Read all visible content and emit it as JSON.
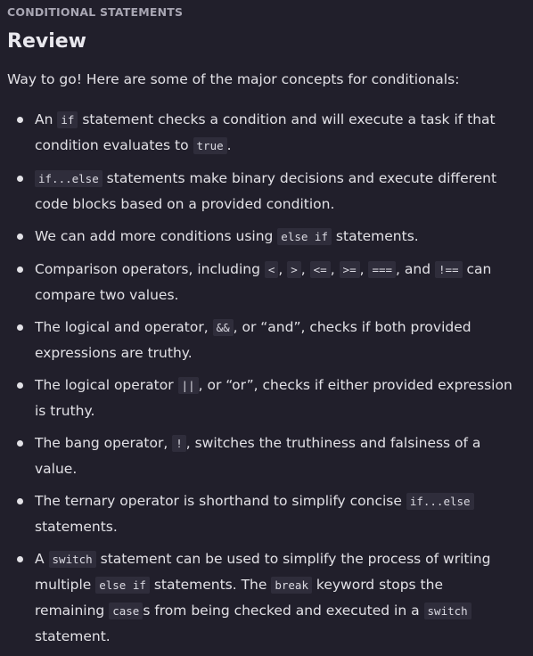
{
  "header": {
    "eyebrow": "CONDITIONAL STATEMENTS",
    "title": "Review",
    "intro": "Way to go! Here are some of the major concepts for conditionals:"
  },
  "items": [
    [
      {
        "t": "An "
      },
      {
        "c": "if"
      },
      {
        "t": " statement checks a condition and will execute a task if that condition evaluates to "
      },
      {
        "c": "true"
      },
      {
        "t": "."
      }
    ],
    [
      {
        "c": "if...else"
      },
      {
        "t": " statements make binary decisions and execute different code blocks based on a provided condition."
      }
    ],
    [
      {
        "t": "We can add more conditions using "
      },
      {
        "c": "else if"
      },
      {
        "t": " statements."
      }
    ],
    [
      {
        "t": "Comparison operators, including "
      },
      {
        "c": "<"
      },
      {
        "t": ", "
      },
      {
        "c": ">"
      },
      {
        "t": ", "
      },
      {
        "c": "<="
      },
      {
        "t": ", "
      },
      {
        "c": ">="
      },
      {
        "t": ", "
      },
      {
        "c": "==="
      },
      {
        "t": ", and "
      },
      {
        "c": "!=="
      },
      {
        "t": " can compare two values."
      }
    ],
    [
      {
        "t": "The logical and operator, "
      },
      {
        "c": "&&"
      },
      {
        "t": ", or “and”, checks if both provided expressions are truthy."
      }
    ],
    [
      {
        "t": "The logical operator "
      },
      {
        "c": "||"
      },
      {
        "t": ", or “or”, checks if either provided expression is truthy."
      }
    ],
    [
      {
        "t": "The bang operator, "
      },
      {
        "c": "!"
      },
      {
        "t": ", switches the truthiness and falsiness of a value."
      }
    ],
    [
      {
        "t": "The ternary operator is shorthand to simplify concise "
      },
      {
        "c": "if...else"
      },
      {
        "t": " statements."
      }
    ],
    [
      {
        "t": "A "
      },
      {
        "c": "switch"
      },
      {
        "t": " statement can be used to simplify the process of writing multiple "
      },
      {
        "c": "else if"
      },
      {
        "t": " statements. The "
      },
      {
        "c": "break"
      },
      {
        "t": " keyword stops the remaining "
      },
      {
        "c": "case"
      },
      {
        "t": "s from being checked and executed in a "
      },
      {
        "c": "switch"
      },
      {
        "t": " statement."
      }
    ]
  ]
}
